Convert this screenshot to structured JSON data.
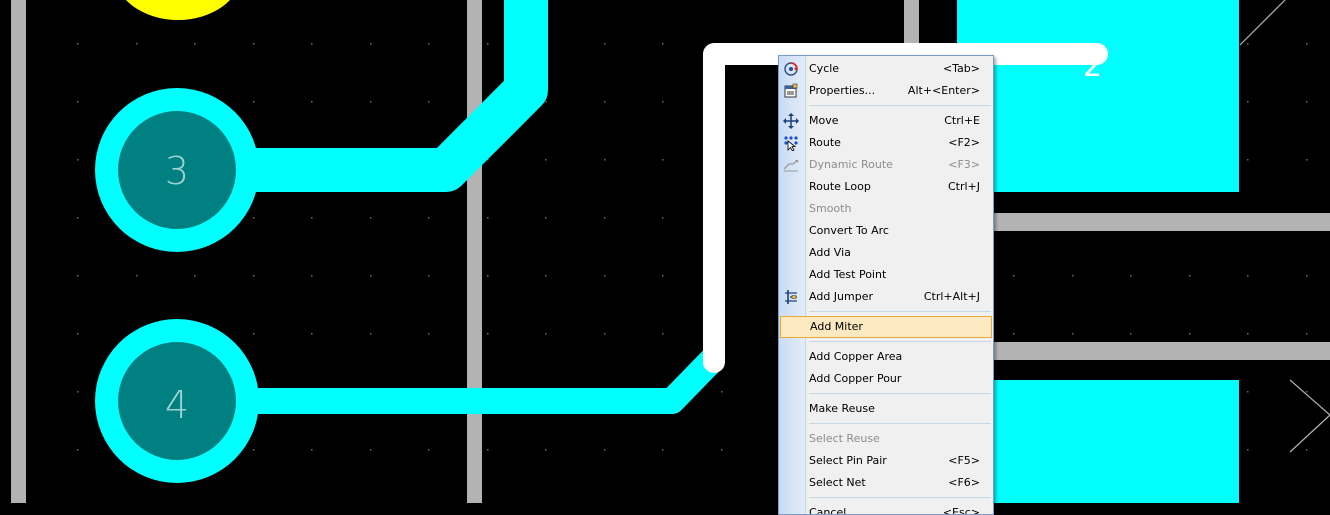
{
  "canvas": {
    "background": "#000000",
    "trace_color": "#00ffff",
    "pad_inner_color": "#008080",
    "selected_trace_color": "#ffffff",
    "grid_bar_color": "#b3b3b3",
    "top_pad_color": "#ffff00",
    "pads": [
      {
        "label": "3"
      },
      {
        "label": "4"
      }
    ],
    "silk_label": "2"
  },
  "menu": {
    "items": [
      {
        "label": "Cycle",
        "shortcut": "<Tab>",
        "icon": "cycle-icon",
        "state": "enabled"
      },
      {
        "label": "Properties...",
        "shortcut": "Alt+<Enter>",
        "icon": "properties-icon",
        "state": "enabled"
      },
      {
        "label": "Move",
        "shortcut": "Ctrl+E",
        "icon": "move-icon",
        "state": "enabled"
      },
      {
        "label": "Route",
        "shortcut": "<F2>",
        "icon": "route-icon",
        "state": "enabled"
      },
      {
        "label": "Dynamic Route",
        "shortcut": "<F3>",
        "icon": "dynamic-route-icon",
        "state": "disabled"
      },
      {
        "label": "Route Loop",
        "shortcut": "Ctrl+J",
        "icon": "",
        "state": "enabled"
      },
      {
        "label": "Smooth",
        "shortcut": "",
        "icon": "",
        "state": "disabled"
      },
      {
        "label": "Convert To Arc",
        "shortcut": "",
        "icon": "",
        "state": "enabled"
      },
      {
        "label": "Add Via",
        "shortcut": "",
        "icon": "",
        "state": "enabled"
      },
      {
        "label": "Add Test Point",
        "shortcut": "",
        "icon": "",
        "state": "enabled"
      },
      {
        "label": "Add Jumper",
        "shortcut": "Ctrl+Alt+J",
        "icon": "add-jumper-icon",
        "state": "enabled"
      },
      {
        "label": "Add Miter",
        "shortcut": "",
        "icon": "",
        "state": "highlighted"
      },
      {
        "label": "Add Copper Area",
        "shortcut": "",
        "icon": "",
        "state": "enabled"
      },
      {
        "label": "Add Copper Pour",
        "shortcut": "",
        "icon": "",
        "state": "enabled"
      },
      {
        "label": "Make Reuse",
        "shortcut": "",
        "icon": "",
        "state": "enabled"
      },
      {
        "label": "Select Reuse",
        "shortcut": "",
        "icon": "",
        "state": "disabled"
      },
      {
        "label": "Select Pin Pair",
        "shortcut": "<F5>",
        "icon": "",
        "state": "enabled"
      },
      {
        "label": "Select Net",
        "shortcut": "<F6>",
        "icon": "",
        "state": "enabled"
      },
      {
        "label": "Cancel",
        "shortcut": "<Esc>",
        "icon": "",
        "state": "enabled"
      }
    ]
  }
}
